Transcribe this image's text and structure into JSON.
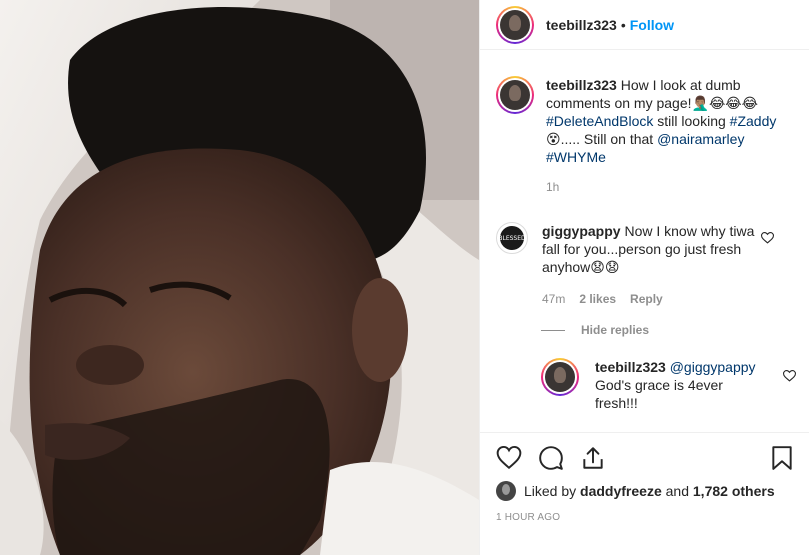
{
  "post": {
    "photo_alt": "",
    "author": "teebillz323",
    "separator": "•",
    "follow_label": "Follow"
  },
  "caption": {
    "username": "teebillz323",
    "text_1": "How I look at dumb comments on my page!🤦🏽‍♂️😂😂😂",
    "hashtag_1": "#DeleteAndBlock",
    "text_2": " still looking ",
    "hashtag_2": "#Zaddy",
    "text_3": "😵..... Still on that ",
    "mention": "@nairamarley",
    "hashtag_3": "#WHYMe",
    "time": "1h"
  },
  "comment": {
    "username": "giggypappy",
    "text": "Now I know why tiwa fall for you...person go just fresh anyhow😧😧",
    "time": "47m",
    "likes": "2 likes",
    "reply_label": "Reply",
    "avatar_text": "BLESSED"
  },
  "hide_replies_label": "Hide replies",
  "reply": {
    "username": "teebillz323",
    "mention": "@giggypappy",
    "text": "God's grace is 4ever fresh!!!"
  },
  "likes_line": {
    "prefix": "Liked by",
    "user": "daddyfreeze",
    "middle": "and",
    "count": "1,782 others"
  },
  "timestamp": "1 HOUR AGO",
  "icons": {
    "like": "heart-icon",
    "comment": "comment-icon",
    "share": "share-icon",
    "save": "bookmark-icon"
  }
}
